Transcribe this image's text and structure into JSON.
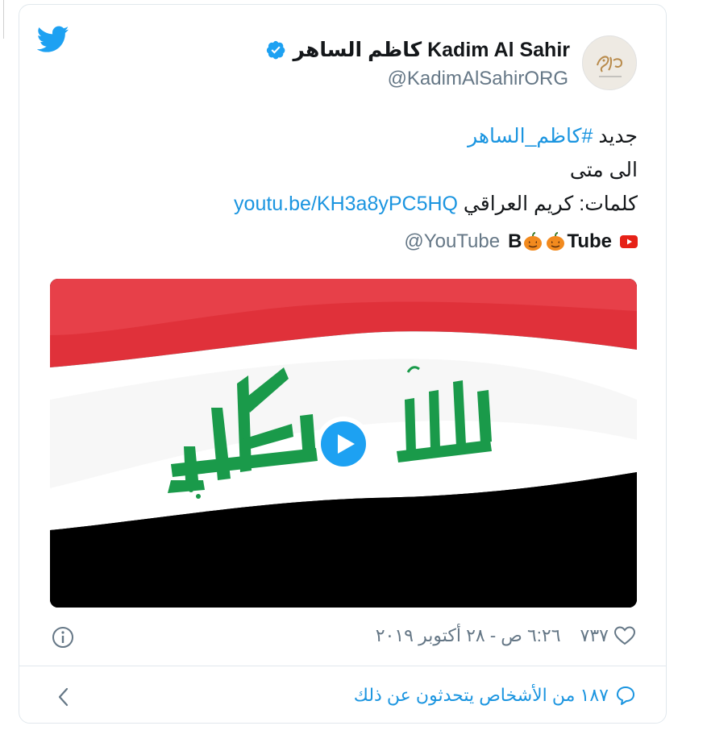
{
  "tweet": {
    "display_name": "كاظم الساهر Kadim Al Sahir",
    "handle": "@KadimAlSahirORG",
    "lines": {
      "line1_prefix": "جديد ",
      "line1_hashtag": "#كاظم_الساهر",
      "line2": "الى متى",
      "line3_prefix": "كلمات: كريم العراقي ",
      "line3_link": "youtu.be/KH3a8yPC5HQ"
    },
    "youtube_source": {
      "left": "B",
      "right": "Tube",
      "mention": "@YouTube"
    }
  },
  "meta": {
    "like_count": "٧٣٧",
    "timestamp": "٦:٢٦ ص - ٢٨ أكتوبر ٢٠١٩"
  },
  "footer": {
    "conversation_text": "١٨٧ من الأشخاص يتحدثون عن ذلك"
  },
  "colors": {
    "accent": "#1b95e0",
    "twitter_blue": "#1da1f2",
    "muted": "#657786",
    "flag_red": "#e0313a",
    "flag_green": "#1a9a4a",
    "flag_black": "#000000"
  },
  "icons": [
    "twitter-bird-icon",
    "verified-badge-icon",
    "youtube-icon",
    "pumpkin-icon",
    "play-icon",
    "heart-icon",
    "info-icon",
    "chat-bubble-icon",
    "chevron-left-icon"
  ]
}
